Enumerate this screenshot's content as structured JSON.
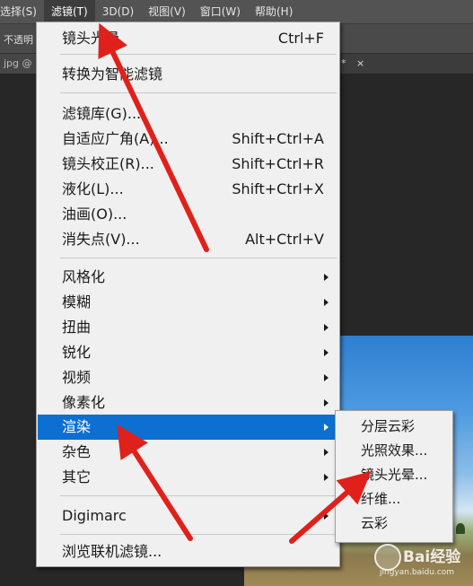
{
  "menubar": {
    "items": [
      "选择(S)",
      "滤镜(T)",
      "3D(D)",
      "视图(V)",
      "窗口(W)",
      "帮助(H)"
    ],
    "active_index": 1
  },
  "options_bar": {
    "opacity_label": "不透明"
  },
  "tabs": {
    "left": "jpg @",
    "right_star": "*",
    "right_close": "×"
  },
  "filter_menu": {
    "last_filter": {
      "label": "镜头光晕",
      "shortcut": "Ctrl+F"
    },
    "convert_smart": {
      "label": "转换为智能滤镜"
    },
    "group2": [
      {
        "label": "滤镜库(G)...",
        "shortcut": ""
      },
      {
        "label": "自适应广角(A)...",
        "shortcut": "Shift+Ctrl+A"
      },
      {
        "label": "镜头校正(R)...",
        "shortcut": "Shift+Ctrl+R"
      },
      {
        "label": "液化(L)...",
        "shortcut": "Shift+Ctrl+X"
      },
      {
        "label": "油画(O)...",
        "shortcut": ""
      },
      {
        "label": "消失点(V)...",
        "shortcut": "Alt+Ctrl+V"
      }
    ],
    "submenus": [
      {
        "label": "风格化"
      },
      {
        "label": "模糊"
      },
      {
        "label": "扭曲"
      },
      {
        "label": "锐化"
      },
      {
        "label": "视频"
      },
      {
        "label": "像素化"
      },
      {
        "label": "渲染",
        "highlighted": true
      },
      {
        "label": "杂色"
      },
      {
        "label": "其它"
      }
    ],
    "digimarc": {
      "label": "Digimarc"
    },
    "browse": {
      "label": "浏览联机滤镜..."
    }
  },
  "render_submenu": {
    "items": [
      "分层云彩",
      "光照效果...",
      "镜头光晕...",
      "纤维...",
      "云彩"
    ]
  },
  "watermark": {
    "main": "Bai经验",
    "sub": "jingyan.baidu.com"
  },
  "colors": {
    "highlight": "#0c6fd1",
    "annotation_arrow": "#e0201b",
    "menu_bg": "#f0f0f0"
  }
}
